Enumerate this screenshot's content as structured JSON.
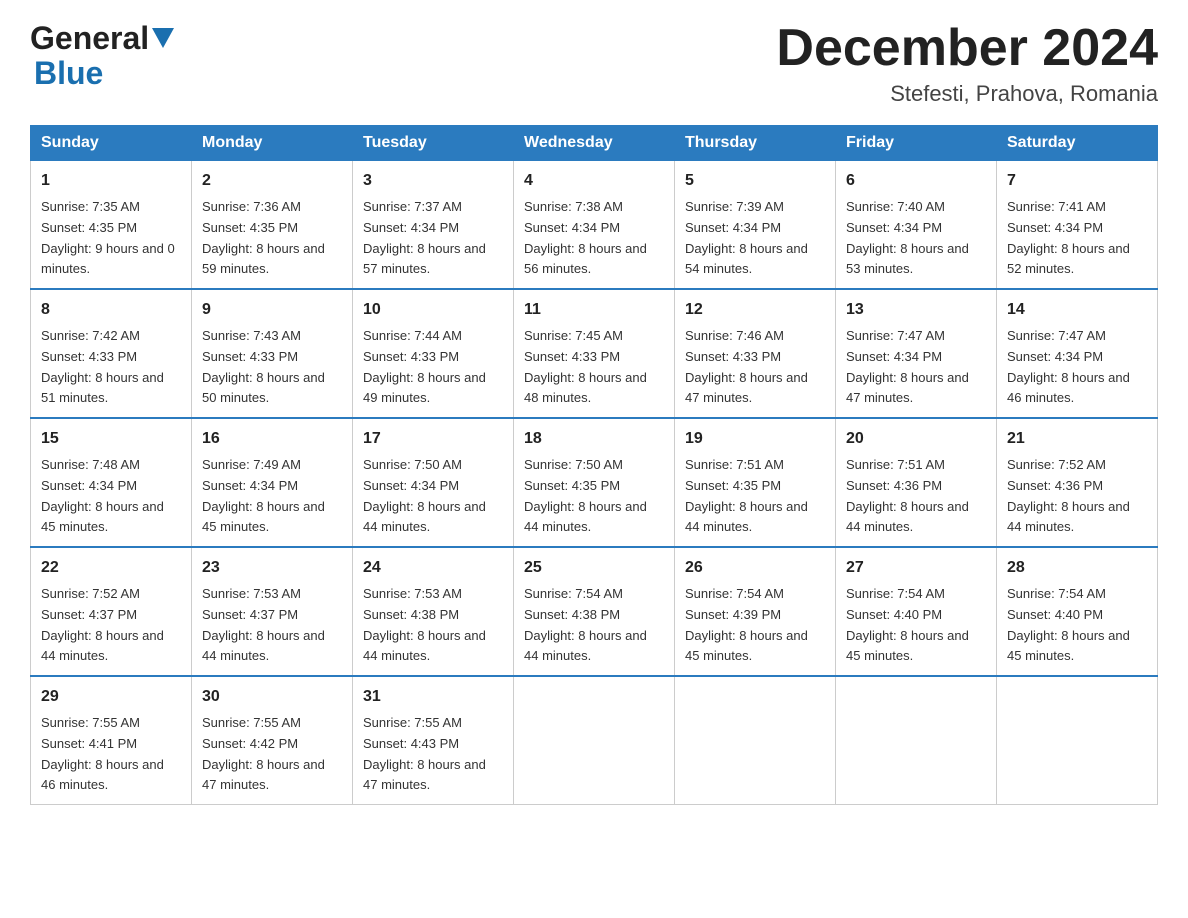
{
  "header": {
    "logo_general": "General",
    "logo_blue": "Blue",
    "month_title": "December 2024",
    "location": "Stefesti, Prahova, Romania"
  },
  "days_of_week": [
    "Sunday",
    "Monday",
    "Tuesday",
    "Wednesday",
    "Thursday",
    "Friday",
    "Saturday"
  ],
  "weeks": [
    [
      {
        "day": "1",
        "sunrise": "Sunrise: 7:35 AM",
        "sunset": "Sunset: 4:35 PM",
        "daylight": "Daylight: 9 hours and 0 minutes."
      },
      {
        "day": "2",
        "sunrise": "Sunrise: 7:36 AM",
        "sunset": "Sunset: 4:35 PM",
        "daylight": "Daylight: 8 hours and 59 minutes."
      },
      {
        "day": "3",
        "sunrise": "Sunrise: 7:37 AM",
        "sunset": "Sunset: 4:34 PM",
        "daylight": "Daylight: 8 hours and 57 minutes."
      },
      {
        "day": "4",
        "sunrise": "Sunrise: 7:38 AM",
        "sunset": "Sunset: 4:34 PM",
        "daylight": "Daylight: 8 hours and 56 minutes."
      },
      {
        "day": "5",
        "sunrise": "Sunrise: 7:39 AM",
        "sunset": "Sunset: 4:34 PM",
        "daylight": "Daylight: 8 hours and 54 minutes."
      },
      {
        "day": "6",
        "sunrise": "Sunrise: 7:40 AM",
        "sunset": "Sunset: 4:34 PM",
        "daylight": "Daylight: 8 hours and 53 minutes."
      },
      {
        "day": "7",
        "sunrise": "Sunrise: 7:41 AM",
        "sunset": "Sunset: 4:34 PM",
        "daylight": "Daylight: 8 hours and 52 minutes."
      }
    ],
    [
      {
        "day": "8",
        "sunrise": "Sunrise: 7:42 AM",
        "sunset": "Sunset: 4:33 PM",
        "daylight": "Daylight: 8 hours and 51 minutes."
      },
      {
        "day": "9",
        "sunrise": "Sunrise: 7:43 AM",
        "sunset": "Sunset: 4:33 PM",
        "daylight": "Daylight: 8 hours and 50 minutes."
      },
      {
        "day": "10",
        "sunrise": "Sunrise: 7:44 AM",
        "sunset": "Sunset: 4:33 PM",
        "daylight": "Daylight: 8 hours and 49 minutes."
      },
      {
        "day": "11",
        "sunrise": "Sunrise: 7:45 AM",
        "sunset": "Sunset: 4:33 PM",
        "daylight": "Daylight: 8 hours and 48 minutes."
      },
      {
        "day": "12",
        "sunrise": "Sunrise: 7:46 AM",
        "sunset": "Sunset: 4:33 PM",
        "daylight": "Daylight: 8 hours and 47 minutes."
      },
      {
        "day": "13",
        "sunrise": "Sunrise: 7:47 AM",
        "sunset": "Sunset: 4:34 PM",
        "daylight": "Daylight: 8 hours and 47 minutes."
      },
      {
        "day": "14",
        "sunrise": "Sunrise: 7:47 AM",
        "sunset": "Sunset: 4:34 PM",
        "daylight": "Daylight: 8 hours and 46 minutes."
      }
    ],
    [
      {
        "day": "15",
        "sunrise": "Sunrise: 7:48 AM",
        "sunset": "Sunset: 4:34 PM",
        "daylight": "Daylight: 8 hours and 45 minutes."
      },
      {
        "day": "16",
        "sunrise": "Sunrise: 7:49 AM",
        "sunset": "Sunset: 4:34 PM",
        "daylight": "Daylight: 8 hours and 45 minutes."
      },
      {
        "day": "17",
        "sunrise": "Sunrise: 7:50 AM",
        "sunset": "Sunset: 4:34 PM",
        "daylight": "Daylight: 8 hours and 44 minutes."
      },
      {
        "day": "18",
        "sunrise": "Sunrise: 7:50 AM",
        "sunset": "Sunset: 4:35 PM",
        "daylight": "Daylight: 8 hours and 44 minutes."
      },
      {
        "day": "19",
        "sunrise": "Sunrise: 7:51 AM",
        "sunset": "Sunset: 4:35 PM",
        "daylight": "Daylight: 8 hours and 44 minutes."
      },
      {
        "day": "20",
        "sunrise": "Sunrise: 7:51 AM",
        "sunset": "Sunset: 4:36 PM",
        "daylight": "Daylight: 8 hours and 44 minutes."
      },
      {
        "day": "21",
        "sunrise": "Sunrise: 7:52 AM",
        "sunset": "Sunset: 4:36 PM",
        "daylight": "Daylight: 8 hours and 44 minutes."
      }
    ],
    [
      {
        "day": "22",
        "sunrise": "Sunrise: 7:52 AM",
        "sunset": "Sunset: 4:37 PM",
        "daylight": "Daylight: 8 hours and 44 minutes."
      },
      {
        "day": "23",
        "sunrise": "Sunrise: 7:53 AM",
        "sunset": "Sunset: 4:37 PM",
        "daylight": "Daylight: 8 hours and 44 minutes."
      },
      {
        "day": "24",
        "sunrise": "Sunrise: 7:53 AM",
        "sunset": "Sunset: 4:38 PM",
        "daylight": "Daylight: 8 hours and 44 minutes."
      },
      {
        "day": "25",
        "sunrise": "Sunrise: 7:54 AM",
        "sunset": "Sunset: 4:38 PM",
        "daylight": "Daylight: 8 hours and 44 minutes."
      },
      {
        "day": "26",
        "sunrise": "Sunrise: 7:54 AM",
        "sunset": "Sunset: 4:39 PM",
        "daylight": "Daylight: 8 hours and 45 minutes."
      },
      {
        "day": "27",
        "sunrise": "Sunrise: 7:54 AM",
        "sunset": "Sunset: 4:40 PM",
        "daylight": "Daylight: 8 hours and 45 minutes."
      },
      {
        "day": "28",
        "sunrise": "Sunrise: 7:54 AM",
        "sunset": "Sunset: 4:40 PM",
        "daylight": "Daylight: 8 hours and 45 minutes."
      }
    ],
    [
      {
        "day": "29",
        "sunrise": "Sunrise: 7:55 AM",
        "sunset": "Sunset: 4:41 PM",
        "daylight": "Daylight: 8 hours and 46 minutes."
      },
      {
        "day": "30",
        "sunrise": "Sunrise: 7:55 AM",
        "sunset": "Sunset: 4:42 PM",
        "daylight": "Daylight: 8 hours and 47 minutes."
      },
      {
        "day": "31",
        "sunrise": "Sunrise: 7:55 AM",
        "sunset": "Sunset: 4:43 PM",
        "daylight": "Daylight: 8 hours and 47 minutes."
      },
      null,
      null,
      null,
      null
    ]
  ]
}
